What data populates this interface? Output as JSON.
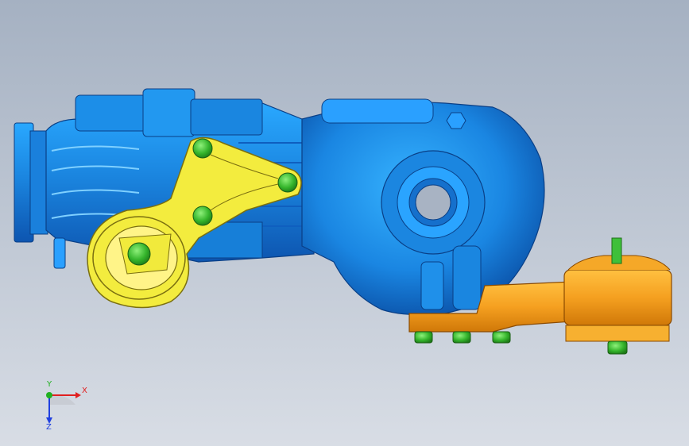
{
  "viewport": {
    "background_top": "#a5b1c2",
    "background_bottom": "#d8dde5"
  },
  "model": {
    "parts": [
      {
        "name": "gearbox-housing",
        "color": "#1e8fe6"
      },
      {
        "name": "engine-mount-bracket",
        "color": "#f1ea3c"
      },
      {
        "name": "rear-mount-bracket",
        "color": "#f29a1a"
      },
      {
        "name": "fastener-bolts",
        "color": "#33b233"
      }
    ]
  },
  "triad": {
    "x_label": "X",
    "y_label": "Y",
    "z_label": "Z",
    "x_color": "#e02020",
    "y_color": "#20b020",
    "z_color": "#2040e0"
  }
}
